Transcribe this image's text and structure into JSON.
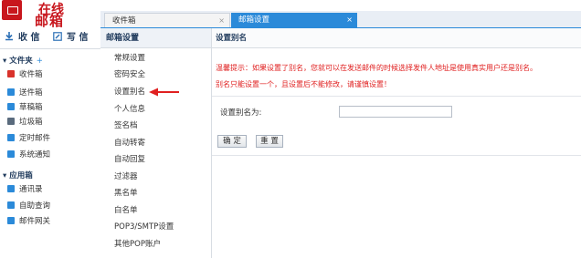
{
  "logo": {
    "brand_top": "在线",
    "brand_bottom": "邮箱",
    "brand_color": "#c8161d"
  },
  "tabs": [
    {
      "label": "收件箱",
      "close": "×",
      "active": false
    },
    {
      "label": "邮箱设置",
      "close": "×",
      "active": true
    }
  ],
  "actions": {
    "receive": "收 信",
    "write": "写 信"
  },
  "sidebar": {
    "folders_title": "文件夹",
    "folders_plus": "+",
    "folders": [
      {
        "label": "收件箱",
        "icon": "inbox-icon",
        "color": "#d9322b"
      },
      {
        "label": "送件箱",
        "icon": "sent-icon",
        "color": "#2b8ad9"
      },
      {
        "label": "草稿箱",
        "icon": "draft-icon",
        "color": "#2b8ad9"
      },
      {
        "label": "垃圾箱",
        "icon": "trash-icon",
        "color": "#5a6b7d"
      },
      {
        "label": "定时邮件",
        "icon": "timer-mail-icon",
        "color": "#2b8ad9"
      },
      {
        "label": "系统通知",
        "icon": "notice-icon",
        "color": "#2b8ad9"
      }
    ],
    "apps_title": "应用箱",
    "apps": [
      {
        "label": "通讯录",
        "icon": "contacts-icon",
        "color": "#2b8ad9"
      },
      {
        "label": "自助查询",
        "icon": "query-icon",
        "color": "#2b8ad9"
      },
      {
        "label": "邮件网关",
        "icon": "gateway-icon",
        "color": "#2b8ad9"
      }
    ]
  },
  "settings_menu": {
    "title": "邮箱设置",
    "items": [
      "常规设置",
      "密码安全",
      "设置别名",
      "个人信息",
      "签名档",
      "自动转寄",
      "自动回复",
      "过滤器",
      "黑名单",
      "白名单",
      "POP3/SMTP设置",
      "其他POP账户"
    ],
    "selected": "设置别名"
  },
  "content": {
    "title": "设置别名",
    "tip": "温馨提示：如果设置了别名，您就可以在发送邮件的时候选择发件人地址是使用真实用户还是别名。",
    "warning": "别名只能设置一个，且设置后不能修改，请谨慎设置！",
    "alias_label": "设置别名为:",
    "alias_value": "",
    "confirm_label": "确 定",
    "reset_label": "重 置"
  },
  "colors": {
    "accent": "#2b8ad9",
    "warning": "#e02020"
  }
}
